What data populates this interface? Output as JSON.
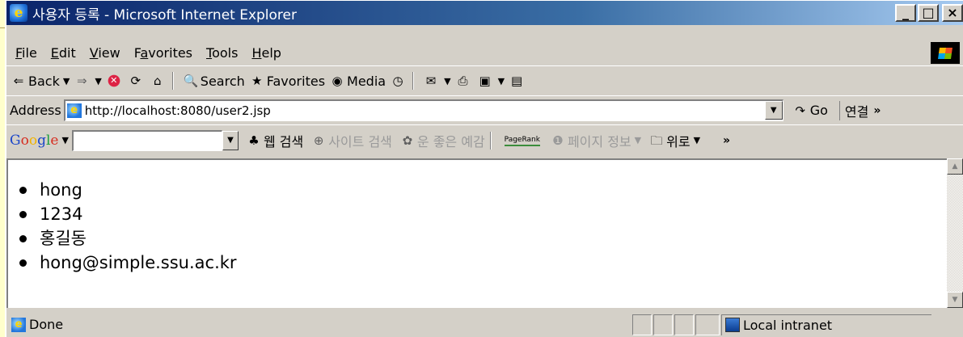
{
  "window": {
    "title": "사용자 등록 - Microsoft Internet Explorer",
    "minimize": "_",
    "maximize": "□",
    "close": "×"
  },
  "menu": {
    "items": [
      {
        "label": "File",
        "key": "F"
      },
      {
        "label": "Edit",
        "key": "E"
      },
      {
        "label": "View",
        "key": "V"
      },
      {
        "label": "Favorites",
        "key": "a"
      },
      {
        "label": "Tools",
        "key": "T"
      },
      {
        "label": "Help",
        "key": "H"
      }
    ]
  },
  "toolbar": {
    "back_label": "Back",
    "search_label": "Search",
    "favorites_label": "Favorites",
    "media_label": "Media"
  },
  "address": {
    "label": "Address",
    "url": "http://localhost:8080/user2.jsp",
    "go_label": "Go",
    "links_label": "연결"
  },
  "googlebar": {
    "logo": [
      "G",
      "o",
      "o",
      "g",
      "l",
      "e"
    ],
    "web_search": "웹 검색",
    "site_search": "사이트 검색",
    "lucky": "운 좋은 예감",
    "pagerank": "PageRank",
    "page_info": "페이지 정보",
    "up": "위로"
  },
  "content": {
    "items": [
      "hong",
      "1234",
      "홍길동",
      "hong@simple.ssu.ac.kr"
    ]
  },
  "status": {
    "text": "Done",
    "zone": "Local intranet"
  }
}
